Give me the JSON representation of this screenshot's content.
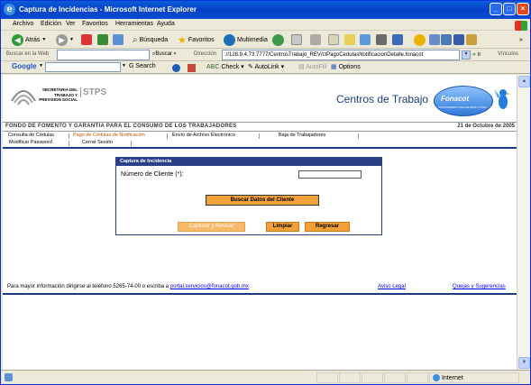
{
  "window": {
    "title": "Captura de Incidencias - Microsoft Internet Explorer"
  },
  "menu": [
    "Archivo",
    "Edición",
    "Ver",
    "Favoritos",
    "Herramientas",
    "Ayuda"
  ],
  "toolbar": {
    "back": "Atrás",
    "search": "Búsqueda",
    "favorites": "Favoritos",
    "multimedia": "Multimedia"
  },
  "addressbar": {
    "search_label": "Buscar en la Web",
    "search_button": "Buscar",
    "address_label": "Dirección",
    "url": "://128.9.4.73:7777/CentrosTrabajo_REV/ctPagoCedulasNotificacionDetalle.fonacot",
    "go": "Ir",
    "links": "Vínculos"
  },
  "googlebar": {
    "logo": "Google",
    "search": "Search",
    "check": "Check",
    "autolink": "AutoLink",
    "autofill": "AutoFill",
    "options": "Options"
  },
  "header": {
    "secretaria_lines": [
      "SECRETARIA DEL",
      "TRABAJO Y",
      "PREVISION SOCIAL"
    ],
    "stps": "STPS",
    "centros": "Centros de Trabajo",
    "fonacot": "Fonacot",
    "fonacot_tagline": "UN INSTRUMENTO PARA MEJORAR TU VIDA Y LA DE TU FAMILIA"
  },
  "fonbar": {
    "name": "FONDO DE FOMENTO Y GARANTIA PARA EL CONSUMO DE LOS TRABAJADORES",
    "date": "21 de Octubre de 2005"
  },
  "nav": {
    "row1": [
      "Consulta de Cédulas",
      "Pago de Cédulas de Notificación",
      "Envío de Archivo Electrónico",
      "Baja de Trabajadores"
    ],
    "row2": [
      "Modificar Password",
      "Cerrar Sesión"
    ]
  },
  "panel": {
    "title": "Captura de Incidencia",
    "field_label": "Número de Cliente (*):",
    "field_value": "",
    "buscar": "Buscar Datos del Cliente",
    "capturar": "Capturar y Revisar",
    "limpiar": "Limpiar",
    "regresar": "Regresar"
  },
  "footer": {
    "info": "Para mayor información dirigirse al teléfono 5265-74-00 o escriba a",
    "email": "portal.servicios@fonacot.gob.mx",
    "aviso": "Aviso Legal",
    "quejas": "Quejas y Sugerencias"
  },
  "status": {
    "zone": "Internet"
  },
  "colors": {
    "accent_blue": "#2a3f86",
    "button_orange": "#f2a13a",
    "nav_active": "#c0560e"
  }
}
